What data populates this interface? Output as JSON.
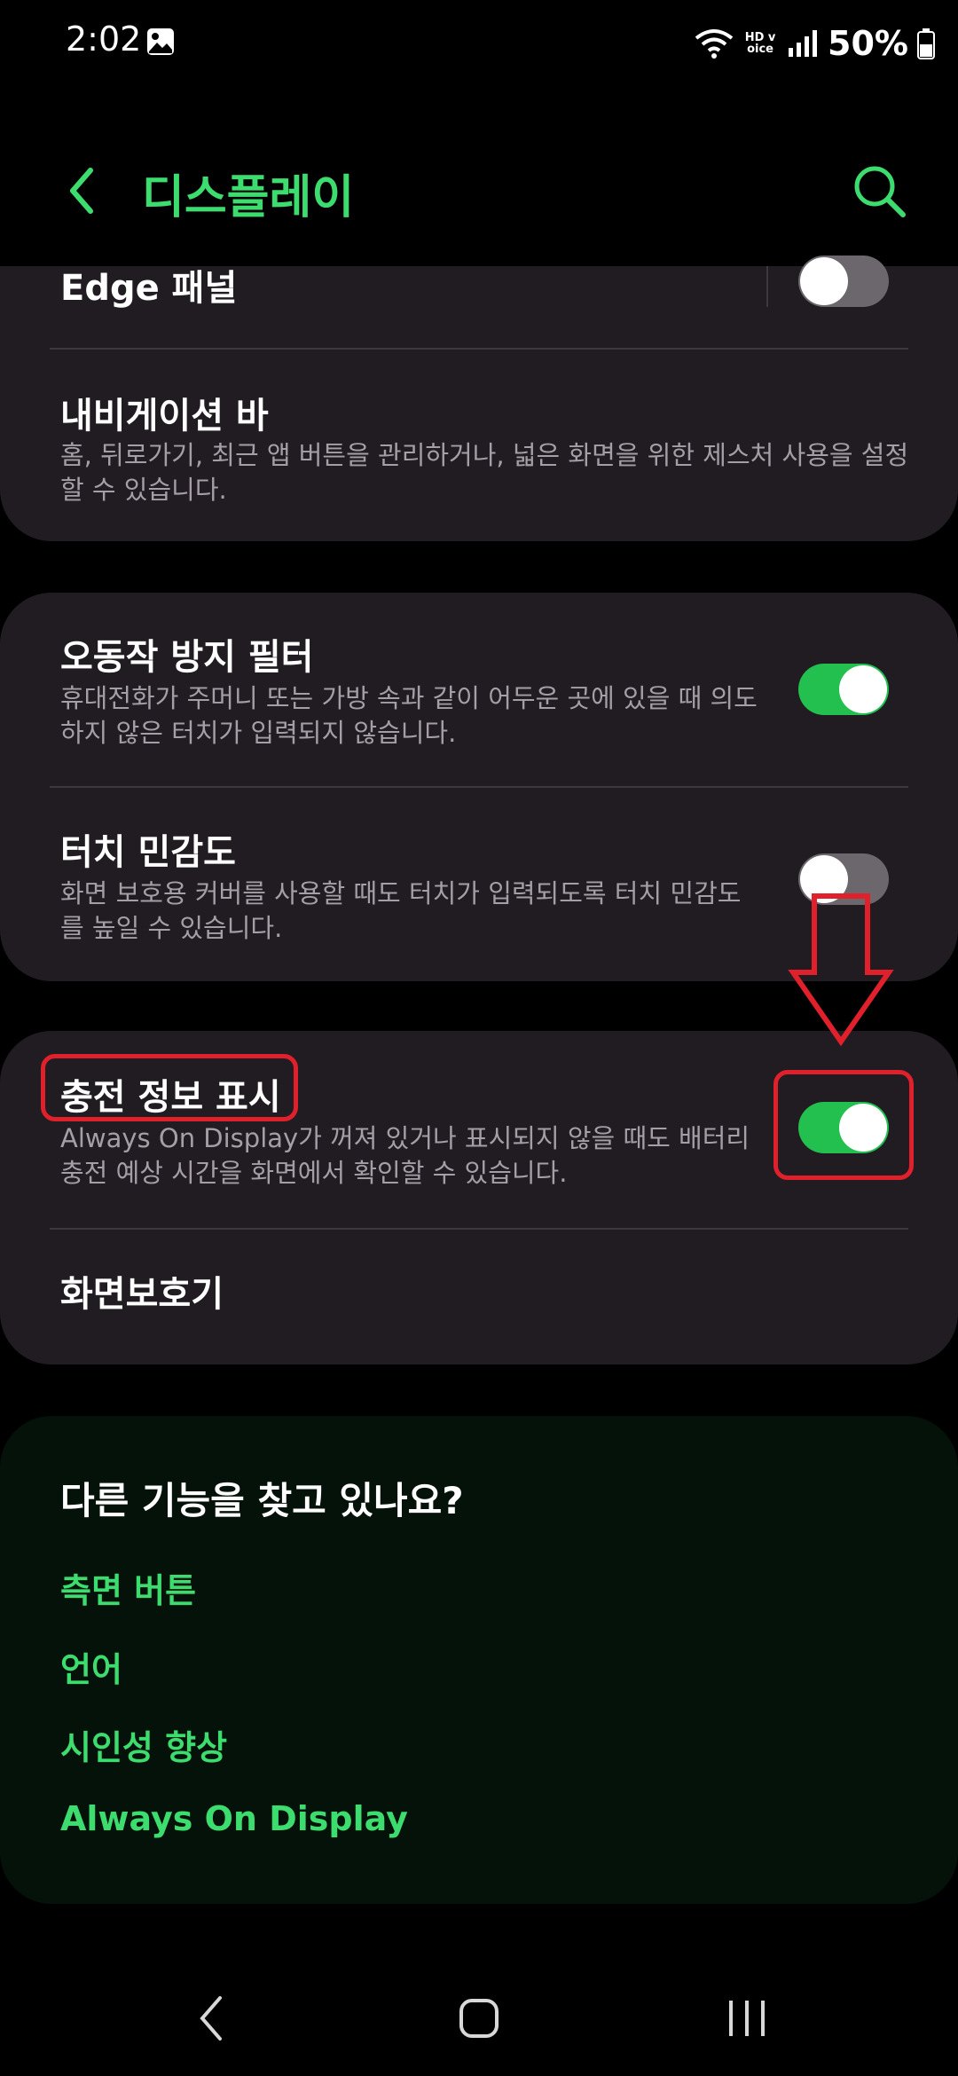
{
  "status_bar": {
    "time": "2:02",
    "network_badge": "HD voice",
    "battery": "50%",
    "icons": [
      "gallery-icon",
      "wifi-icon",
      "hd-voice-icon",
      "signal-icon",
      "battery-icon"
    ]
  },
  "app_bar": {
    "title": "디스플레이",
    "back_icon": "chevron-left-icon",
    "search_icon": "search-icon"
  },
  "settings": {
    "edge_panel": {
      "title": "Edge 패널",
      "enabled": false
    },
    "navigation_bar": {
      "title": "내비게이션 바",
      "desc": "홈, 뒤로가기, 최근 앱 버튼을 관리하거나, 넓은 화면을 위한 제스처 사용을 설정할 수 있습니다."
    },
    "accidental_touch": {
      "title": "오동작 방지 필터",
      "desc": "휴대전화가 주머니 또는 가방 속과 같이 어두운 곳에 있을 때 의도하지 않은 터치가 입력되지 않습니다.",
      "enabled": true
    },
    "touch_sensitivity": {
      "title": "터치 민감도",
      "desc": "화면 보호용 커버를 사용할 때도 터치가 입력되도록 터치 민감도를 높일 수 있습니다.",
      "enabled": false
    },
    "charging_info": {
      "title": "충전 정보 표시",
      "desc": "Always On Display가 꺼져 있거나 표시되지 않을 때도 배터리 충전 예상 시간을 화면에서 확인할 수 있습니다.",
      "enabled": true
    },
    "screen_saver": {
      "title": "화면보호기"
    }
  },
  "related": {
    "title": "다른 기능을 찾고 있나요?",
    "links": [
      "측면 버튼",
      "언어",
      "시인성 향상",
      "Always On Display"
    ]
  },
  "annotations": {
    "highlight_color": "#e0202b",
    "accent_color": "#3ddc6e",
    "toggle_on_color": "#23c050"
  },
  "nav_bar": {
    "icons": [
      "back-icon",
      "home-icon",
      "recents-icon"
    ]
  }
}
